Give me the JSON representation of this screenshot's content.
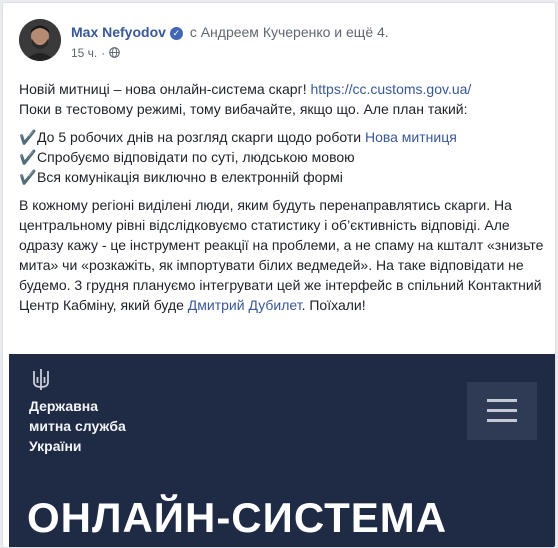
{
  "post": {
    "author": "Max Nefyodov",
    "with_prefix": "с",
    "with_names": "Андреем Кучеренко и ещё 4.",
    "time": "15 ч.",
    "icons": {
      "verified": "verified-badge-icon",
      "audience": "globe-icon"
    },
    "intro_text": "Новій митниці – нова онлайн-система скарг! ",
    "intro_link": "https://cc.customs.gov.ua/",
    "line2": "Поки в тестовому режимі, тому вибачайте, якщо що. Але план такий:",
    "bullets": [
      {
        "check": "✔️",
        "text": "До 5 робочих днів на розгляд скарги щодо роботи ",
        "link": "Нова митниця"
      },
      {
        "check": "✔️",
        "text": "Спробуємо відповідати по суті, людською мовою",
        "link": ""
      },
      {
        "check": "✔️",
        "text": "Вся комунікація виключно в електронній формі",
        "link": ""
      }
    ],
    "body_text": "В кожному регіоні виділені люди, яким будуть перенаправлятись скарги. На центральному рівні відслідковуємо статистику і об’єктивність відповіді. Але одразу кажу - це інструмент реакції на проблеми, а не спаму на кшталт «знизьте мита» чи «розкажіть, як імпортувати білих ведмедей». На таке відповідати не будемо. 3 грудня плануємо інтегрувати цей же інтерфейс в спільний Контактний Центр Кабміну, який буде ",
    "body_link": "Дмитрий Дубилет",
    "body_end": ". Поїхали!"
  },
  "banner": {
    "agency": "Державна\nмитна служба\nУкраїни",
    "title": "ОНЛАЙН-СИСТЕМА",
    "icons": {
      "emblem": "trident-icon",
      "menu": "hamburger-menu-icon"
    }
  }
}
